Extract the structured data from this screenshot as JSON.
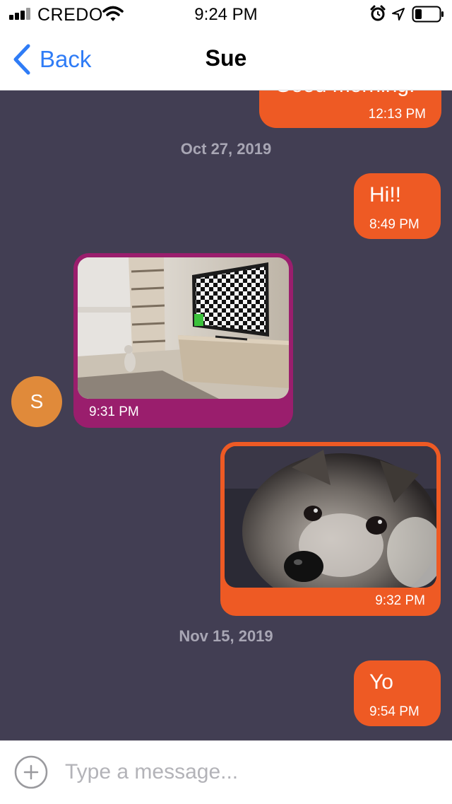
{
  "status_bar": {
    "carrier": "CREDO",
    "time": "9:24 PM",
    "icons": [
      "signal-icon",
      "wifi-icon",
      "alarm-icon",
      "location-icon",
      "battery-icon"
    ]
  },
  "nav": {
    "back_label": "Back",
    "title": "Sue"
  },
  "conversation": {
    "messages": [
      {
        "direction": "outgoing",
        "text": "Good morning!",
        "time": "12:13 PM"
      },
      {
        "type": "date",
        "text": "Oct 27, 2019"
      },
      {
        "direction": "outgoing",
        "text": "Hi!!",
        "time": "8:49 PM"
      },
      {
        "direction": "incoming",
        "sender_initial": "S",
        "image": "room-with-tv-photo",
        "time": "9:31 PM"
      },
      {
        "direction": "outgoing",
        "image": "dog-photo",
        "time": "9:32 PM"
      },
      {
        "type": "date",
        "text": "Nov 15, 2019"
      },
      {
        "direction": "outgoing",
        "text": "Yo",
        "time": "9:54 PM"
      }
    ]
  },
  "composer": {
    "placeholder": "Type a message...",
    "value": ""
  },
  "colors": {
    "chat_background": "#423e53",
    "outgoing_bubble": "#ee5a24",
    "incoming_bubble": "#9a1e6d",
    "avatar": "#e08a3a",
    "accent": "#2f7cf6"
  }
}
